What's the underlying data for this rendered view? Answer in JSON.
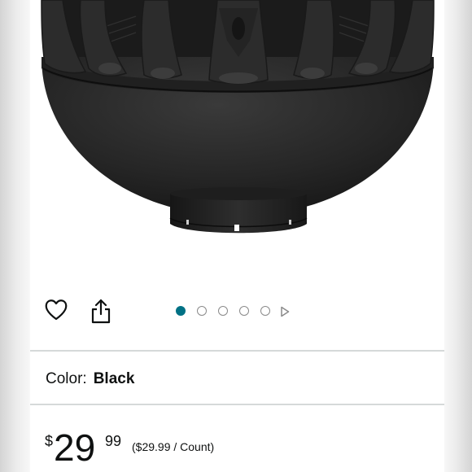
{
  "product": {
    "image_alt": "Black diffuser attachment",
    "icons": {
      "wishlist": "heart-icon",
      "share": "share-icon",
      "next": "triangle-right-icon"
    },
    "carousel": {
      "total_dots": 5,
      "active_index": 0
    },
    "color": {
      "label": "Color:",
      "value": "Black"
    },
    "price": {
      "symbol": "$",
      "whole": "29",
      "fraction": "99",
      "per_unit": "($29.99 / Count)"
    }
  },
  "colors": {
    "accent": "#007185",
    "product": "#2a2a2a",
    "divider": "#d5d9d9",
    "text": "#0f1111"
  }
}
